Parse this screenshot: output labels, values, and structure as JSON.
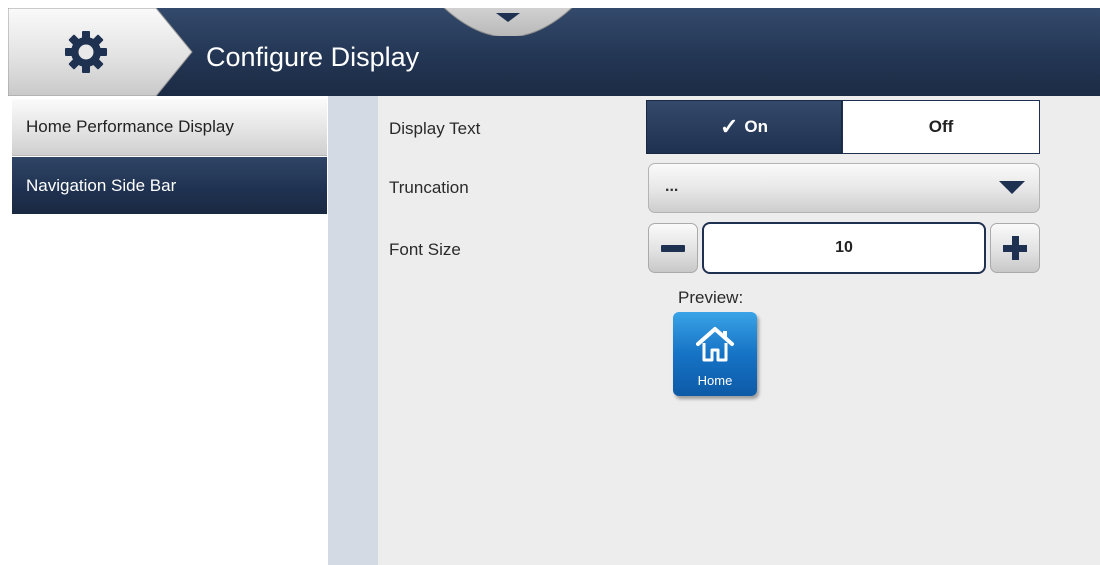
{
  "header": {
    "title": "Configure Display",
    "settings_icon": "gear-icon",
    "pulltab_icon": "chevron-down-icon"
  },
  "sidebar": {
    "items": [
      {
        "label": "Home Performance Display",
        "selected": true
      },
      {
        "label": "Navigation Side Bar",
        "selected": false
      }
    ]
  },
  "form": {
    "display_text": {
      "label": "Display Text",
      "options": [
        "On",
        "Off"
      ],
      "selected": "On"
    },
    "truncation": {
      "label": "Truncation",
      "value": "..."
    },
    "font_size": {
      "label": "Font Size",
      "value": "10"
    },
    "preview": {
      "label": "Preview:",
      "tile_label": "Home",
      "tile_icon": "home-icon"
    }
  },
  "colors": {
    "header_navy": "#1f3150",
    "tile_blue": "#1673c6",
    "divider": "#d3dae4"
  }
}
